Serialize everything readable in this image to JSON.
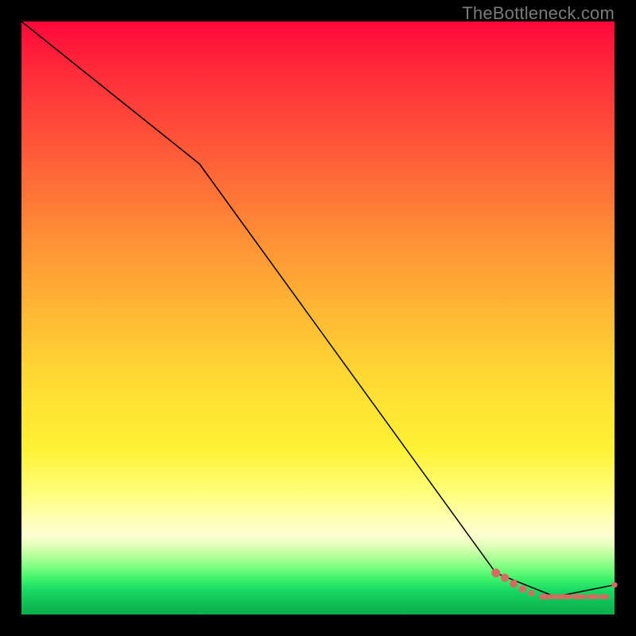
{
  "credit_text": "TheBottleneck.com",
  "chart_data": {
    "type": "line",
    "title": "",
    "xlabel": "",
    "ylabel": "",
    "xlim": [
      0,
      100
    ],
    "ylim": [
      0,
      100
    ],
    "grid": false,
    "legend": false,
    "background": "rainbow-vertical-gradient",
    "series": [
      {
        "name": "black-curve",
        "x": [
          0,
          30,
          80,
          90,
          100
        ],
        "y": [
          100,
          76,
          7,
          3,
          5
        ]
      }
    ],
    "markers": {
      "color": "#d96a62",
      "points": [
        {
          "x": 80.0,
          "y": 7.0,
          "r": 5.5
        },
        {
          "x": 81.5,
          "y": 6.2,
          "r": 5.2
        },
        {
          "x": 83.0,
          "y": 5.2,
          "r": 5.0
        },
        {
          "x": 84.5,
          "y": 4.3,
          "r": 4.7
        },
        {
          "x": 86.0,
          "y": 3.6,
          "r": 4.0
        },
        {
          "x": 88.0,
          "y": 3.0,
          "r": 3.7
        },
        {
          "x": 90.0,
          "y": 3.0,
          "r": 3.2
        },
        {
          "x": 100.0,
          "y": 5.0,
          "r": 3.6
        }
      ],
      "dashes": [
        {
          "x": 88.5,
          "w": 2.5
        },
        {
          "x": 91.5,
          "w": 2.5
        },
        {
          "x": 94.0,
          "w": 2.5
        },
        {
          "x": 96.3,
          "w": 2.0
        },
        {
          "x": 98.2,
          "w": 1.8
        }
      ]
    }
  }
}
